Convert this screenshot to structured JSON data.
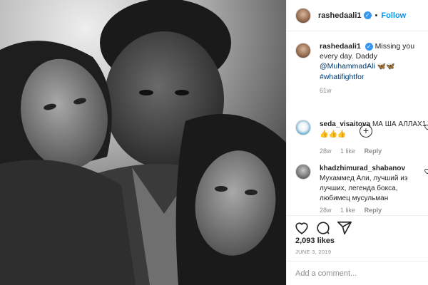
{
  "header": {
    "username": "rashedaali1",
    "verified_glyph": "✓",
    "separator": "•",
    "follow_label": "Follow"
  },
  "caption": {
    "username": "rashedaali1",
    "text_a": "Missing you every day.",
    "text_b": "Daddy",
    "mention": "@MuhammadAli",
    "emoji": "🦋🦋",
    "hashtag": "#whatifightfor",
    "time": "61w"
  },
  "load_more_icon": "plus-circle-icon",
  "load_more_glyph": "+",
  "comments": [
    {
      "username": "seda_visaitova",
      "text": "МА ША АЛЛАХ1",
      "emoji": "👍👍👍",
      "time": "28w",
      "likes": "1 like",
      "reply": "Reply"
    },
    {
      "username": "khadzhimurad_shabanov",
      "text": "Мухаммед Али, лучший из лучших, легенда бокса, любимец мусульман",
      "time": "28w",
      "likes": "1 like",
      "reply": "Reply"
    }
  ],
  "actions": {
    "icons": [
      "heart-icon",
      "comment-icon",
      "share-icon"
    ]
  },
  "likes_count": "2,093 likes",
  "post_date": "JUNE 3, 2019",
  "add_comment": {
    "placeholder": "Add a comment..."
  },
  "colors": {
    "link": "#0095f6",
    "verified": "#3897f0",
    "muted": "#8e8e8e",
    "text": "#262626"
  }
}
